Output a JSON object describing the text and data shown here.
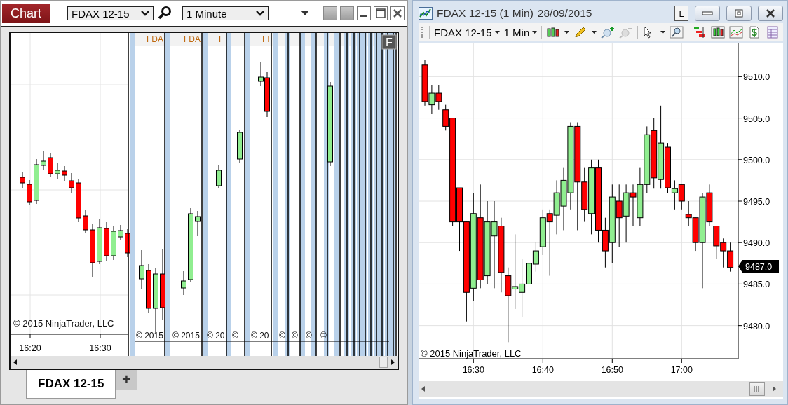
{
  "left_window": {
    "tab_title": "Chart",
    "instrument": "FDAX 12-15",
    "timeframe": "1 Minute",
    "chart": {
      "overlay_badge": "F",
      "copyright": "© 2015 NinjaTrader, LLC",
      "time_labels": [
        "16:20",
        "16:30"
      ],
      "header_fragments": [
        "FDA",
        "FDA",
        "F",
        "FI"
      ],
      "footer_fragments": [
        "© 2015",
        "© 2015",
        "© 20",
        "©",
        "© 20",
        "©",
        "©",
        "©",
        "©"
      ]
    },
    "tabs": [
      {
        "label": "FDAX 12-15",
        "selected": true
      }
    ],
    "add_tab": "+"
  },
  "right_window": {
    "title": "FDAX 12-15 (1 Min)",
    "date": "28/09/2015",
    "layout_button": "L",
    "toolbar": {
      "instrument": "FDAX 12-15",
      "interval": "1 Min"
    },
    "chart": {
      "last_price": "9487.0",
      "copyright": "© 2015 NinjaTrader, LLC",
      "chart_data": {
        "type": "candlestick",
        "categories": [
          null,
          null,
          null,
          null,
          null,
          null,
          null,
          "16:30",
          null,
          null,
          null,
          null,
          null,
          null,
          null,
          null,
          null,
          "16:40",
          null,
          null,
          null,
          null,
          null,
          null,
          null,
          null,
          null,
          "16:50",
          null,
          null,
          null,
          null,
          null,
          null,
          null,
          null,
          null,
          "17:00",
          null,
          null,
          null,
          null,
          null,
          null,
          null
        ],
        "yticks": [
          {
            "value": 9510,
            "label": "9510.0"
          },
          {
            "value": 9505,
            "label": "9505.0"
          },
          {
            "value": 9500,
            "label": "9500.0"
          },
          {
            "value": 9495,
            "label": "9495.0"
          },
          {
            "value": 9490,
            "label": "9490.0"
          },
          {
            "value": 9485,
            "label": "9485.0"
          },
          {
            "value": 9480,
            "label": "9480.0"
          }
        ],
        "ylim": [
          9476,
          9514
        ],
        "grid": true,
        "ohlc": [
          [
            9511.4,
            9512,
            9506.5,
            9507
          ],
          [
            9506.6,
            9509,
            9505.5,
            9508
          ],
          [
            9508,
            9509,
            9506,
            9507
          ],
          [
            9506,
            9506.6,
            9503.5,
            9504
          ],
          [
            9505,
            9505,
            9492,
            9492.5
          ],
          [
            9496.6,
            9496.6,
            9489,
            9492.5
          ],
          [
            9492.5,
            9492.5,
            9480.5,
            9484
          ],
          [
            9484.5,
            9496,
            9483,
            9493.5
          ],
          [
            9493,
            9497,
            9484.5,
            9485.5
          ],
          [
            9486,
            9495,
            9485,
            9492.5
          ],
          [
            9490.8,
            9495,
            9484.5,
            9492.5
          ],
          [
            9492,
            9493,
            9484,
            9486.4
          ],
          [
            9486,
            9487,
            9478,
            9483.6
          ],
          [
            9484.4,
            9491,
            9482,
            9484.7
          ],
          [
            9484,
            9488,
            9481,
            9485
          ],
          [
            9485,
            9489,
            9484,
            9487.5
          ],
          [
            9487.4,
            9490,
            9486.5,
            9489
          ],
          [
            9489.5,
            9494,
            9488.5,
            9493
          ],
          [
            9493.5,
            9494,
            9486,
            9492.5
          ],
          [
            9493.3,
            9497.5,
            9491,
            9496
          ],
          [
            9494.4,
            9499,
            9491.5,
            9497.5
          ],
          [
            9496,
            9504.5,
            9494,
            9504
          ],
          [
            9504,
            9504.5,
            9491.5,
            9497.3
          ],
          [
            9497.3,
            9499,
            9492.5,
            9494
          ],
          [
            9493.5,
            9500,
            9491,
            9499
          ],
          [
            9499,
            9500,
            9490,
            9491.5
          ],
          [
            9491.5,
            9493,
            9487,
            9489
          ],
          [
            9490,
            9497,
            9487.5,
            9495.5
          ],
          [
            9495,
            9497,
            9489.5,
            9493
          ],
          [
            9493.2,
            9497,
            9490,
            9496
          ],
          [
            9496,
            9497,
            9492,
            9495.5
          ],
          [
            9493,
            9499,
            9492,
            9497
          ],
          [
            9497,
            9504,
            9496,
            9503
          ],
          [
            9503.5,
            9505,
            9496.5,
            9497.8
          ],
          [
            9497.6,
            9506.5,
            9496.5,
            9502
          ],
          [
            9501.5,
            9502,
            9496,
            9496.6
          ],
          [
            9496,
            9497.5,
            9494,
            9496.5
          ],
          [
            9497,
            9497,
            9494,
            9495
          ],
          [
            9493.4,
            9495,
            9492,
            9493
          ],
          [
            9493,
            9493,
            9489,
            9490
          ],
          [
            9490,
            9496,
            9484.5,
            9495.5
          ],
          [
            9496,
            9497,
            9492,
            9492.5
          ],
          [
            9492,
            9492,
            9488,
            9489.6
          ],
          [
            9490,
            9490.5,
            9487,
            9489
          ],
          [
            9489,
            9490,
            9486.5,
            9487
          ]
        ]
      }
    }
  }
}
